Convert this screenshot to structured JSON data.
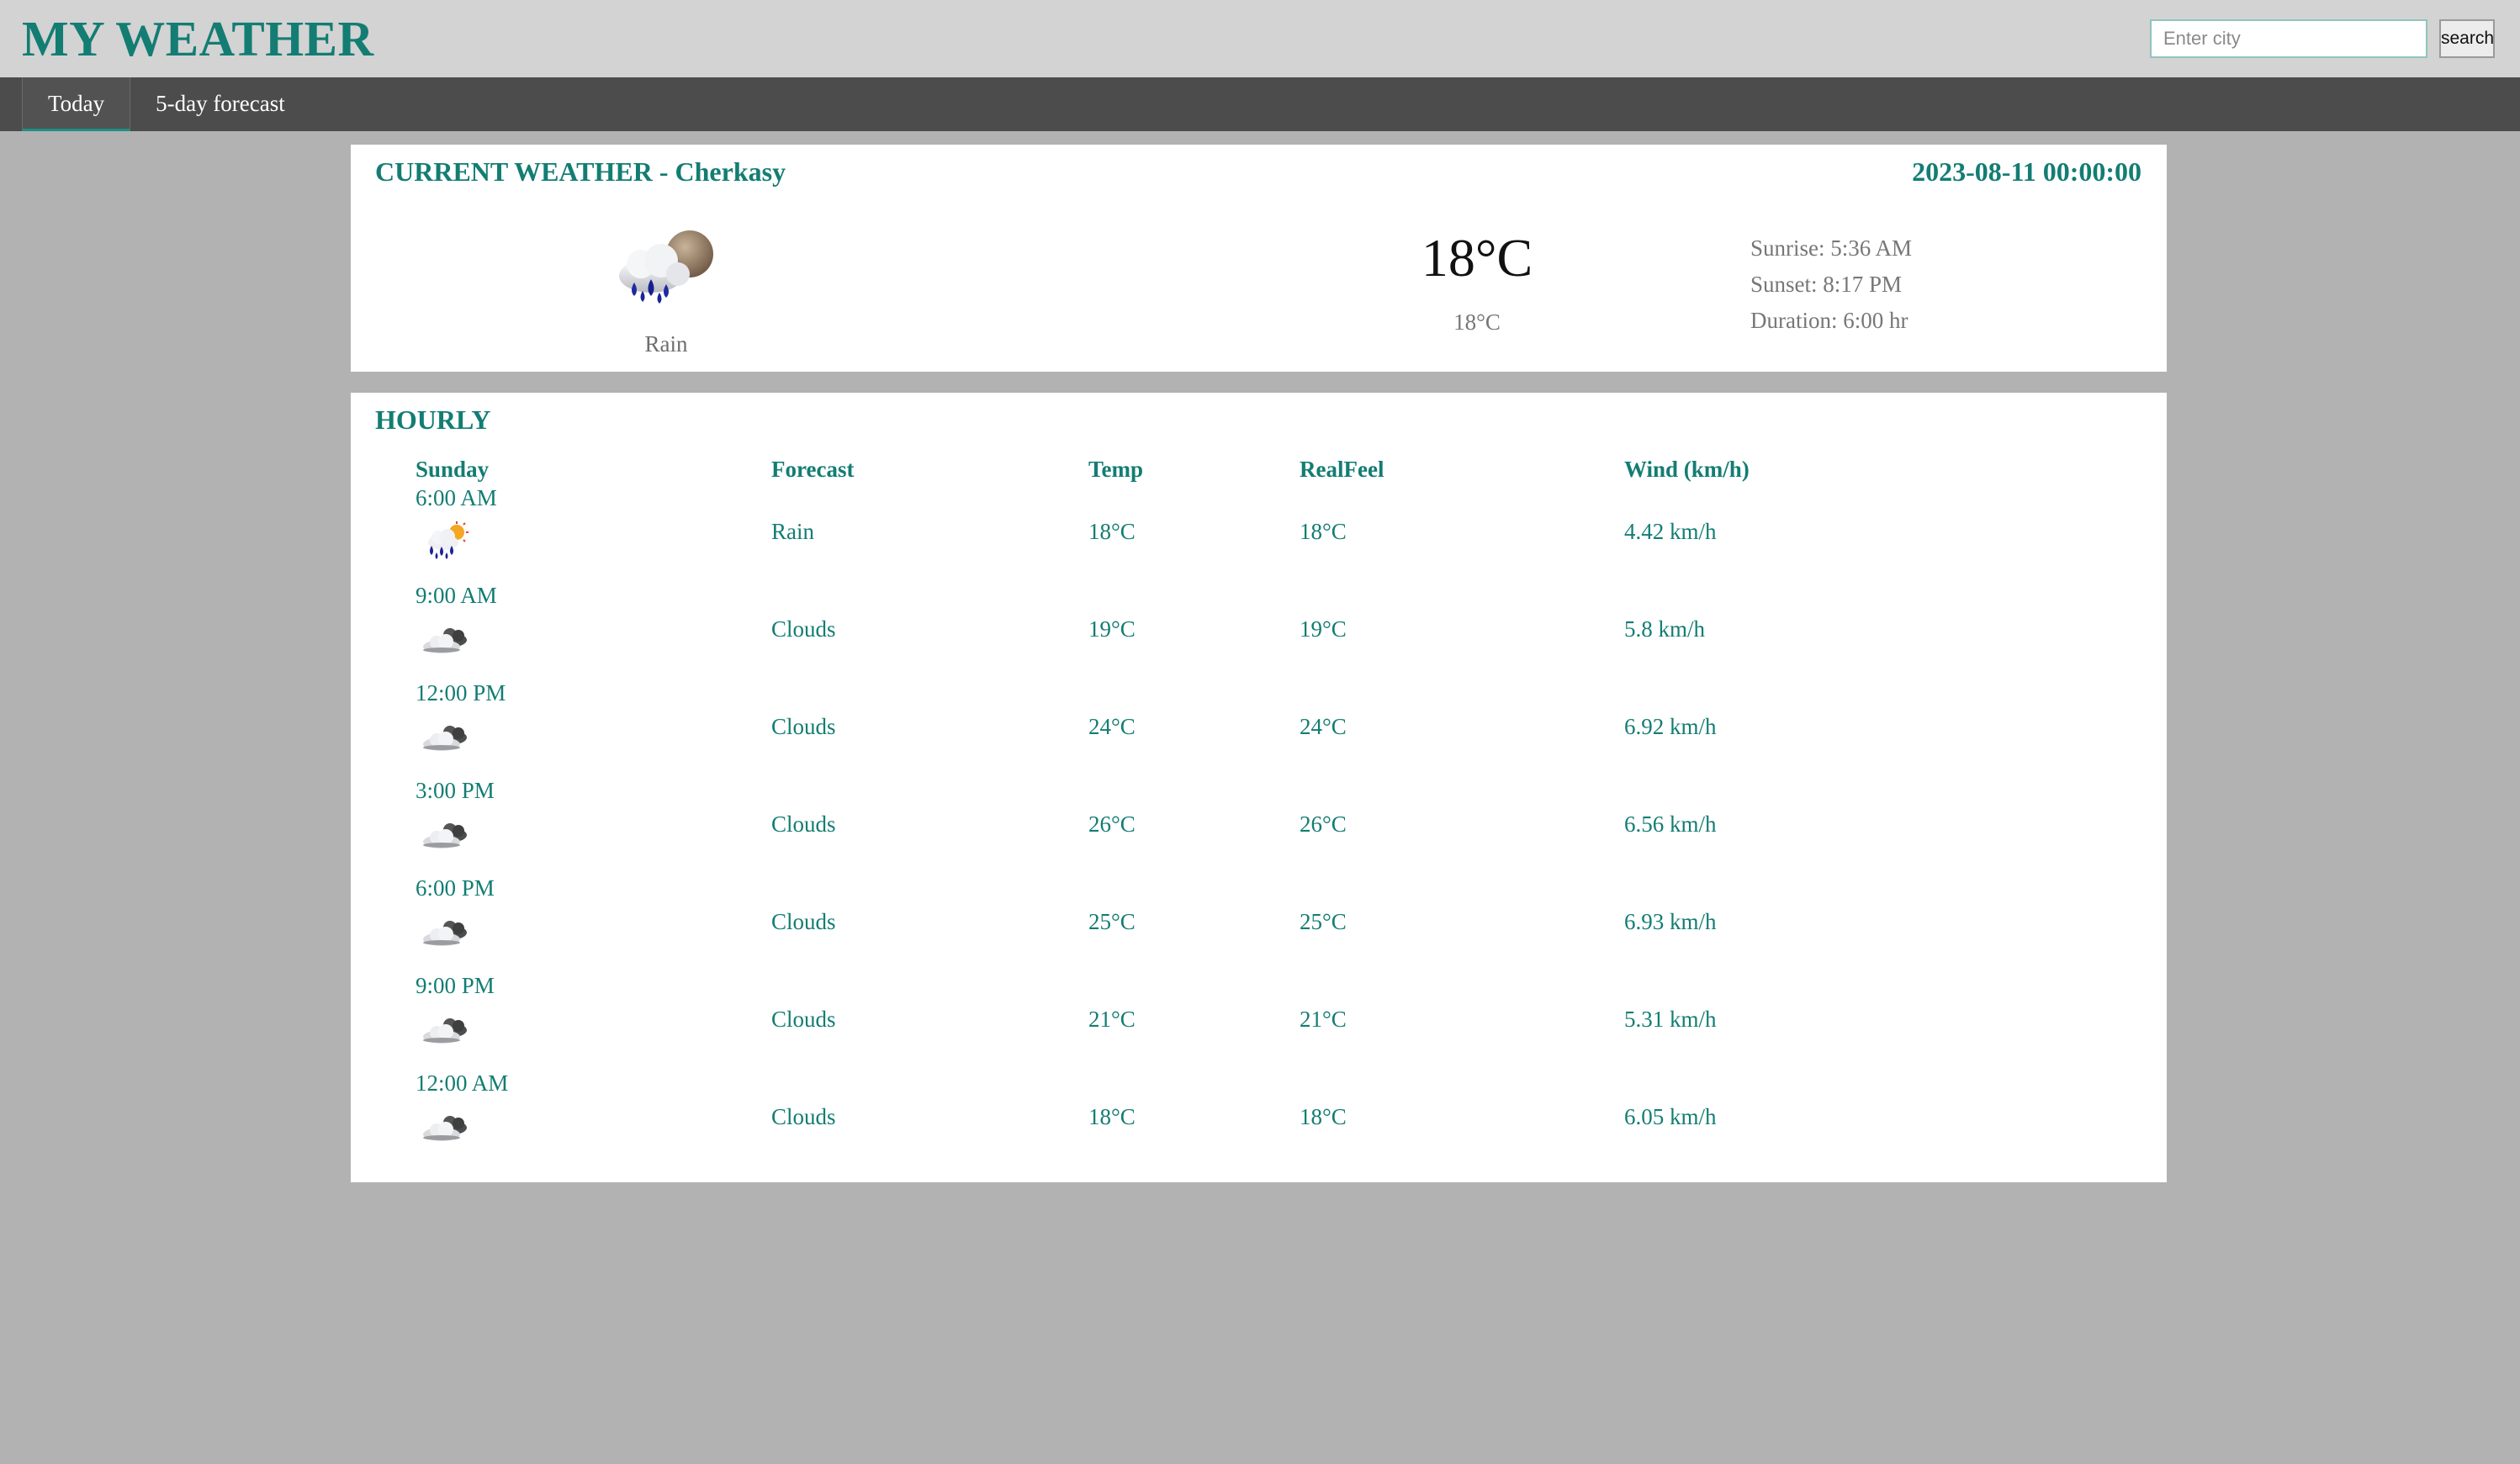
{
  "header": {
    "logo": "MY WEATHER",
    "search": {
      "placeholder": "Enter city",
      "value": "",
      "button_label": "search"
    }
  },
  "nav": {
    "tabs": [
      {
        "label": "Today",
        "active": true
      },
      {
        "label": "5-day forecast",
        "active": false
      }
    ]
  },
  "current": {
    "title": "CURRENT WEATHER - Cherkasy",
    "datetime": "2023-08-11 00:00:00",
    "icon": "rain-moon-icon",
    "condition": "Rain",
    "temp": "18°C",
    "realfeel": "18°C",
    "sunrise": "Sunrise: 5:36 AM",
    "sunset": "Sunset: 8:17 PM",
    "duration": "Duration: 6:00 hr"
  },
  "hourly": {
    "title": "HOURLY",
    "headers": {
      "day": "Sunday",
      "forecast": "Forecast",
      "temp": "Temp",
      "realfeel": "RealFeel",
      "wind": "Wind (km/h)"
    },
    "rows": [
      {
        "time": "6:00 AM",
        "icon": "rain-sun-icon",
        "forecast": "Rain",
        "temp": "18°C",
        "realfeel": "18°C",
        "wind": "4.42 km/h"
      },
      {
        "time": "9:00 AM",
        "icon": "clouds-icon",
        "forecast": "Clouds",
        "temp": "19°C",
        "realfeel": "19°C",
        "wind": "5.8 km/h"
      },
      {
        "time": "12:00 PM",
        "icon": "clouds-icon",
        "forecast": "Clouds",
        "temp": "24°C",
        "realfeel": "24°C",
        "wind": "6.92 km/h"
      },
      {
        "time": "3:00 PM",
        "icon": "clouds-icon",
        "forecast": "Clouds",
        "temp": "26°C",
        "realfeel": "26°C",
        "wind": "6.56 km/h"
      },
      {
        "time": "6:00 PM",
        "icon": "clouds-icon",
        "forecast": "Clouds",
        "temp": "25°C",
        "realfeel": "25°C",
        "wind": "6.93 km/h"
      },
      {
        "time": "9:00 PM",
        "icon": "clouds-icon",
        "forecast": "Clouds",
        "temp": "21°C",
        "realfeel": "21°C",
        "wind": "5.31 km/h"
      },
      {
        "time": "12:00 AM",
        "icon": "clouds-icon",
        "forecast": "Clouds",
        "temp": "18°C",
        "realfeel": "18°C",
        "wind": "6.05 km/h"
      }
    ]
  },
  "colors": {
    "accent": "#137d73",
    "page_bg": "#b3b2b3",
    "header_bg": "#d3d3d3",
    "nav_bg": "#4c4c4c"
  }
}
